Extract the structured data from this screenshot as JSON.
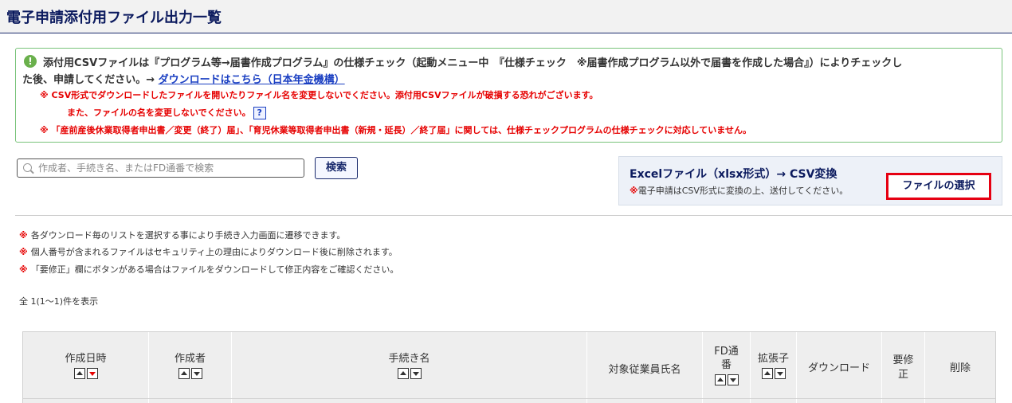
{
  "header": {
    "title": "電子申請添付用ファイル出力一覧"
  },
  "notice": {
    "icon": "info-icon",
    "line1": "添付用CSVファイルは『プログラム等→届書作成プログラム』の仕様チェック（起動メニュー中　『仕様チェック　※届書作成プログラム以外で届書を作成した場合』）によりチェックし",
    "line2_prefix": "た後、申請してください。→ ",
    "download_link": "ダウンロードはこちら（日本年金機構）",
    "warn1": "※ CSV形式でダウンロードしたファイルを開いたりファイル名を変更しないでください。添付用CSVファイルが破損する恐れがございます。",
    "warn2": "また、ファイルの名を変更しないでください。",
    "help_label": "?",
    "warn3": "※ 「産前産後休業取得者申出書／変更（終了）届」、「育児休業等取得者申出書（新規・延長）／終了届」に関しては、仕様チェックプログラムの仕様チェックに対応していません。"
  },
  "search": {
    "placeholder": "作成者、手続き名、またはFD通番で検索",
    "value": "",
    "button_label": "検索"
  },
  "convert": {
    "title": "Excelファイル（xlsx形式）→ CSV変換",
    "note_mark": "※",
    "note": "電子申請はCSV形式に変換の上、送付してください。",
    "file_button_label": "ファイルの選択"
  },
  "notes": [
    {
      "mark": "※",
      "text": "各ダウンロード毎のリストを選択する事により手続き入力画面に遷移できます。"
    },
    {
      "mark": "※",
      "text": "個人番号が含まれるファイルはセキュリティ上の理由によりダウンロード後に削除されます。"
    },
    {
      "mark": "※",
      "text": "「要修正」欄にボタンがある場合はファイルをダウンロードして修正内容をご確認ください。"
    }
  ],
  "count_text": "全 1(1〜1)件を表示",
  "table": {
    "columns": [
      {
        "label": "作成日時",
        "sortable": true,
        "active_sort": "desc"
      },
      {
        "label": "作成者",
        "sortable": true
      },
      {
        "label": "手続き名",
        "sortable": true
      },
      {
        "label": "対象従業員氏名",
        "sortable": false
      },
      {
        "label_line1": "FD通",
        "label_line2": "番",
        "sortable": true
      },
      {
        "label": "拡張子",
        "sortable": true
      },
      {
        "label": "ダウンロード",
        "sortable": false
      },
      {
        "label_line1": "要修",
        "label_line2": "正",
        "sortable": false
      },
      {
        "label": "削除",
        "sortable": false
      }
    ]
  }
}
